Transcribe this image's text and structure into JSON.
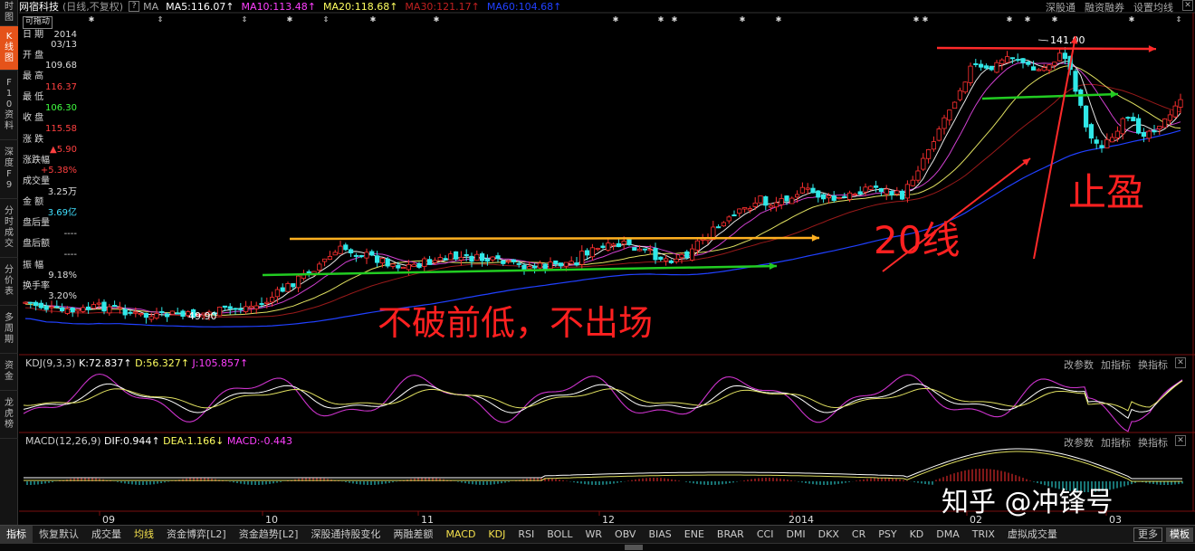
{
  "left_tabs": [
    {
      "label": "时图",
      "active": false
    },
    {
      "label": "K线图",
      "active": true
    },
    {
      "label": "F10资料",
      "active": false
    },
    {
      "label": "深度F9",
      "active": false
    },
    {
      "label": "分时成交",
      "active": false
    },
    {
      "label": "分价表",
      "active": false
    },
    {
      "label": "多周期",
      "active": false
    },
    {
      "label": "资金",
      "active": false
    },
    {
      "label": "龙虎榜",
      "active": false
    }
  ],
  "topbar": {
    "stock": "网宿科技",
    "mode": "(日线,不复权)",
    "q": "?",
    "ma_label": "MA",
    "ma": [
      {
        "label": "MA5:116.07",
        "color": "#ffffff"
      },
      {
        "label": "MA10:113.48",
        "color": "#ff40ff"
      },
      {
        "label": "MA20:118.68",
        "color": "#ffff60"
      },
      {
        "label": "MA30:121.17",
        "color": "#c02020"
      },
      {
        "label": "MA60:104.68",
        "color": "#2040ff"
      }
    ],
    "right_links": [
      "深股通",
      "融资融券",
      "设置均线"
    ],
    "close": "✕"
  },
  "info": {
    "tag": "可拖动",
    "rows": [
      {
        "label": "日 期",
        "value": "2014",
        "color": "#ddd"
      },
      {
        "label": "",
        "value": "03/13",
        "color": "#ddd"
      },
      {
        "label": "开 盘",
        "value": "",
        "color": "#ddd"
      },
      {
        "label": "",
        "value": "109.68",
        "color": "#ddd"
      },
      {
        "label": "最 高",
        "value": "",
        "color": "#ddd"
      },
      {
        "label": "",
        "value": "116.37",
        "color": "#ff4040"
      },
      {
        "label": "最 低",
        "value": "",
        "color": "#ddd"
      },
      {
        "label": "",
        "value": "106.30",
        "color": "#40ff40"
      },
      {
        "label": "收 盘",
        "value": "",
        "color": "#ddd"
      },
      {
        "label": "",
        "value": "115.58",
        "color": "#ff4040"
      },
      {
        "label": "涨 跌",
        "value": "",
        "color": "#ddd"
      },
      {
        "label": "",
        "value": "▲5.90",
        "color": "#ff4040"
      },
      {
        "label": "涨跌幅",
        "value": "",
        "color": "#ddd"
      },
      {
        "label": "",
        "value": "+5.38%",
        "color": "#ff4040"
      },
      {
        "label": "成交量",
        "value": "",
        "color": "#ddd"
      },
      {
        "label": "",
        "value": "3.25万",
        "color": "#ddd"
      },
      {
        "label": "金 额",
        "value": "",
        "color": "#ddd"
      },
      {
        "label": "",
        "value": "3.69亿",
        "color": "#40e0ff"
      },
      {
        "label": "盘后量",
        "value": "",
        "color": "#ddd"
      },
      {
        "label": "",
        "value": "----",
        "color": "#ddd"
      },
      {
        "label": "盘后额",
        "value": "",
        "color": "#ddd"
      },
      {
        "label": "",
        "value": "----",
        "color": "#ddd"
      },
      {
        "label": "振 幅",
        "value": "",
        "color": "#ddd"
      },
      {
        "label": "",
        "value": "9.18%",
        "color": "#ddd"
      },
      {
        "label": "换手率",
        "value": "",
        "color": "#ddd"
      },
      {
        "label": "",
        "value": "3.20%",
        "color": "#ddd"
      }
    ]
  },
  "main_chart": {
    "high_label": "141.00",
    "low_label": "49.90",
    "annotations": {
      "no_break": "不破前低，不出场",
      "line20": "20线",
      "take_profit": "止盈"
    }
  },
  "kdj": {
    "name": "KDJ(9,3,3)",
    "k": "K:72.837",
    "d": "D:56.327",
    "j": "J:105.857",
    "buttons": [
      "改参数",
      "加指标",
      "换指标"
    ]
  },
  "macd": {
    "name": "MACD(12,26,9)",
    "dif": "DIF:0.944",
    "dea": "DEA:1.166",
    "macd": "MACD:-0.443",
    "buttons": [
      "改参数",
      "加指标",
      "换指标"
    ]
  },
  "x_axis": [
    "09",
    "10",
    "11",
    "12",
    "2014",
    "02",
    "03"
  ],
  "watermark": "知乎 @冲锋号",
  "bottom_tabs": [
    {
      "label": "指标",
      "style": "sel"
    },
    {
      "label": "恢复默认",
      "style": ""
    },
    {
      "label": "成交量",
      "style": ""
    },
    {
      "label": "均线",
      "style": "hl"
    },
    {
      "label": "资金博弈[L2]",
      "style": ""
    },
    {
      "label": "资金趋势[L2]",
      "style": ""
    },
    {
      "label": "深股通持股变化",
      "style": ""
    },
    {
      "label": "两融差额",
      "style": ""
    },
    {
      "label": "MACD",
      "style": "hl"
    },
    {
      "label": "KDJ",
      "style": "hl"
    },
    {
      "label": "RSI",
      "style": ""
    },
    {
      "label": "BOLL",
      "style": ""
    },
    {
      "label": "WR",
      "style": ""
    },
    {
      "label": "OBV",
      "style": ""
    },
    {
      "label": "BIAS",
      "style": ""
    },
    {
      "label": "ENE",
      "style": ""
    },
    {
      "label": "BRAR",
      "style": ""
    },
    {
      "label": "CCI",
      "style": ""
    },
    {
      "label": "DMI",
      "style": ""
    },
    {
      "label": "DKX",
      "style": ""
    },
    {
      "label": "CR",
      "style": ""
    },
    {
      "label": "PSY",
      "style": ""
    },
    {
      "label": "KD",
      "style": ""
    },
    {
      "label": "DMA",
      "style": ""
    },
    {
      "label": "TRIX",
      "style": ""
    },
    {
      "label": "虚拟成交量",
      "style": ""
    }
  ],
  "bottom_more": "更多",
  "bottom_template": "模板"
}
